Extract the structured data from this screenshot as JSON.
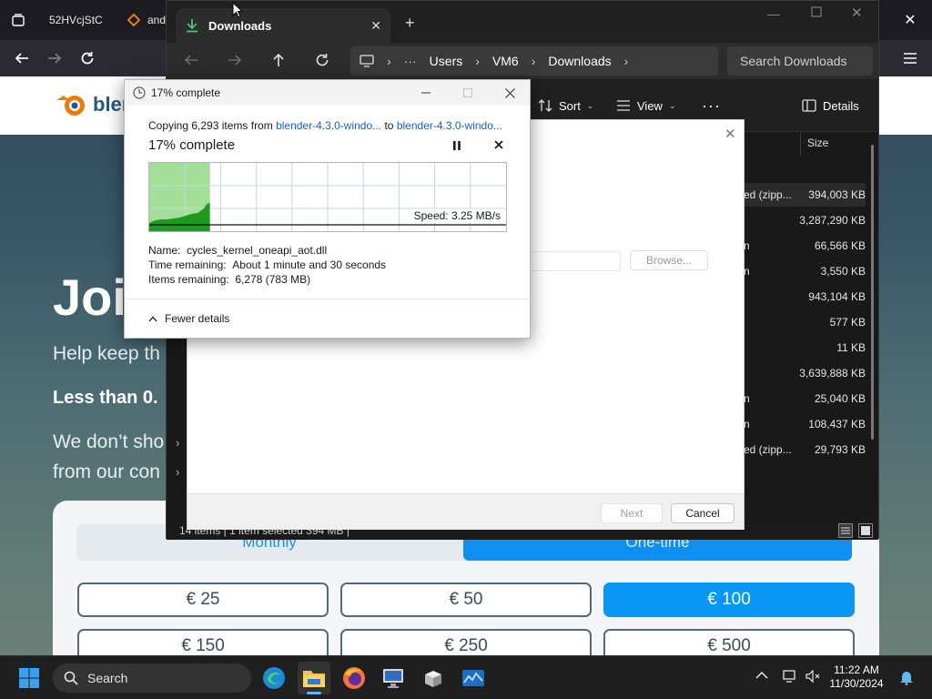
{
  "browser": {
    "tabs": [
      {
        "label": "52HVcjStC"
      },
      {
        "label": "andr"
      }
    ],
    "web": {
      "logo_text": "blen",
      "headline": "Joi",
      "help_text": "Help keep th",
      "less_text": "Less than 0.",
      "we_dont_line1": "We don’t sho",
      "we_dont_line2": "from our con",
      "toggle": {
        "monthly": "Monthly",
        "one_time": "One-time",
        "selected": "One-time"
      },
      "amounts": [
        "€ 25",
        "€ 50",
        "€ 100",
        "€ 150",
        "€ 250",
        "€ 500"
      ],
      "selected_amount": "€ 100",
      "accent_color": "#0a96f5"
    }
  },
  "explorer": {
    "tab_title": "Downloads",
    "breadcrumb": [
      "Users",
      "VM6",
      "Downloads"
    ],
    "search_placeholder": "Search Downloads",
    "commands": {
      "sort": "Sort",
      "view": "View",
      "details": "Details"
    },
    "size_header": "Size",
    "rows": [
      {
        "type": "ed (zipp...",
        "size": "394,003 KB"
      },
      {
        "type": "",
        "size": "3,287,290 KB"
      },
      {
        "type": "n",
        "size": "66,566 KB"
      },
      {
        "type": "n",
        "size": "3,550 KB"
      },
      {
        "type": "",
        "size": "943,104 KB"
      },
      {
        "type": "",
        "size": "577 KB"
      },
      {
        "type": "",
        "size": "11 KB"
      },
      {
        "type": "",
        "size": "3,639,888 KB"
      },
      {
        "type": "n",
        "size": "25,040 KB"
      },
      {
        "type": "n",
        "size": "108,437 KB"
      },
      {
        "type": "ed (zipp...",
        "size": "29,793 KB"
      }
    ],
    "status": "14 items  |  1 item selected  394 MB  |"
  },
  "wizard": {
    "browse": "Browse...",
    "next": "Next",
    "cancel": "Cancel"
  },
  "copy_dialog": {
    "title": "17% complete",
    "copying_prefix": "Copying 6,293 items from ",
    "source": "blender-4.3.0-windo...",
    "to_word": " to ",
    "destination": "blender-4.3.0-windo...",
    "percent_text": "17% complete",
    "progress_fraction": 0.17,
    "speed": "Speed: 3.25 MB/s",
    "name_label": "Name:",
    "name_value": "cycles_kernel_oneapi_aot.dll",
    "time_label": "Time remaining:",
    "time_value": "About 1 minute and 30 seconds",
    "items_label": "Items remaining:",
    "items_value": "6,278 (783 MB)",
    "fewer_details": "Fewer details"
  },
  "taskbar": {
    "search_label": "Search",
    "time": "11:22 AM",
    "date": "11/30/2024"
  }
}
